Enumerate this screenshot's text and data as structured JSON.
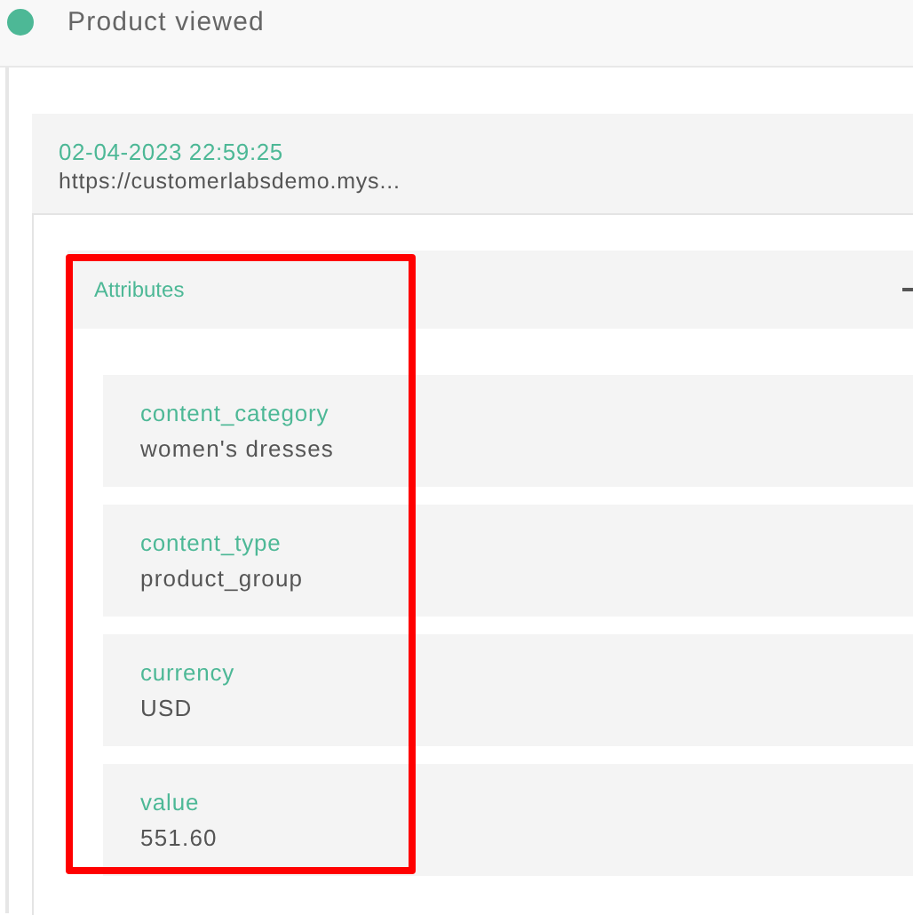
{
  "event": {
    "title": "Product viewed",
    "color": "#4db896"
  },
  "record": {
    "timestamp": "02-04-2023 22:59:25",
    "url": "https://customerlabsdemo.mys..."
  },
  "attributes": {
    "title": "Attributes",
    "highlighted": true,
    "expanded": true,
    "items": [
      {
        "key": "content_category",
        "value": "women's dresses"
      },
      {
        "key": "content_type",
        "value": "product_group"
      },
      {
        "key": "currency",
        "value": "USD"
      },
      {
        "key": "value",
        "value": "551.60"
      }
    ]
  }
}
